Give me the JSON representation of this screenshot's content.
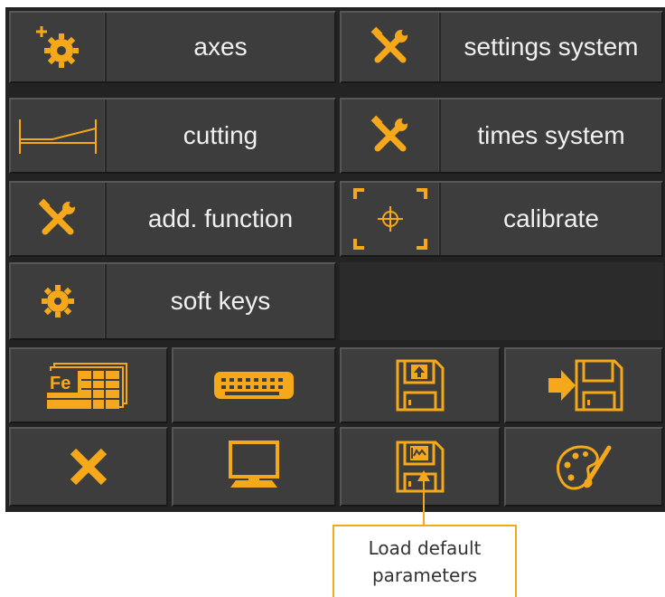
{
  "colors": {
    "accent": "#f5a81a",
    "panel_bg": "#232323",
    "button_bg": "#3d3d3d",
    "label_text": "#f0f0f0"
  },
  "menu": {
    "axes": {
      "label": "axes",
      "icon": "gear-plus-icon"
    },
    "settings_system": {
      "label": "settings system",
      "icon": "tools-icon"
    },
    "cutting": {
      "label": "cutting",
      "icon": "cutting-table-icon"
    },
    "times_system": {
      "label": "times system",
      "icon": "tools-icon"
    },
    "add_function": {
      "label": "add. function",
      "icon": "tools-icon"
    },
    "calibrate": {
      "label": "calibrate",
      "icon": "crosshair-icon"
    },
    "soft_keys": {
      "label": "soft keys",
      "icon": "gear-icon"
    }
  },
  "icon_buttons": [
    {
      "icon": "fe-table-icon"
    },
    {
      "icon": "keyboard-icon"
    },
    {
      "icon": "floppy-upload-icon"
    },
    {
      "icon": "floppy-import-icon"
    },
    {
      "icon": "close-icon"
    },
    {
      "icon": "monitor-icon"
    },
    {
      "icon": "floppy-graph-icon"
    },
    {
      "icon": "palette-icon"
    }
  ],
  "callout": {
    "line1": "Load default",
    "line2": "parameters"
  }
}
